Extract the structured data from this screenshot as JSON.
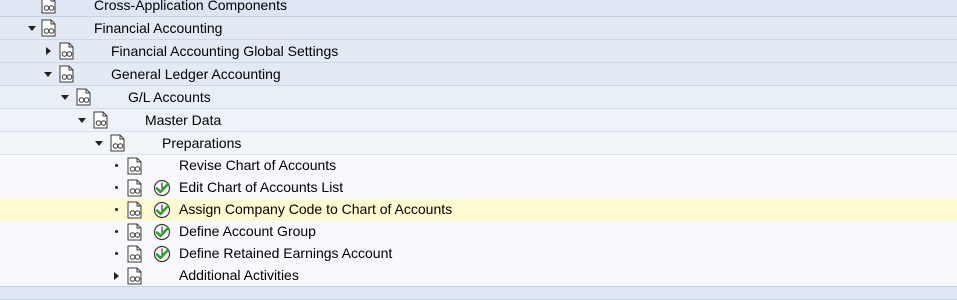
{
  "tree": {
    "cross_application": "Cross-Application Components",
    "financial_accounting": "Financial Accounting",
    "fa_global_settings": "Financial Accounting Global Settings",
    "general_ledger": "General Ledger Accounting",
    "gl_accounts": "G/L Accounts",
    "master_data": "Master Data",
    "preparations": "Preparations",
    "revise_chart": "Revise Chart of Accounts",
    "edit_chart_list": "Edit Chart of Accounts List",
    "assign_company_code": "Assign Company Code to Chart of Accounts",
    "define_account_group": "Define Account Group",
    "define_retained_earnings": "Define Retained Earnings Account",
    "additional_activities": "Additional Activities"
  },
  "icons": {
    "node": "img-activity-document-icon",
    "execute": "execute-activity-clock-icon"
  },
  "colors": {
    "selected_row": "#fffbd1",
    "header_rows": "#dde6f2",
    "leaf_rows": "#f7f9fc"
  }
}
